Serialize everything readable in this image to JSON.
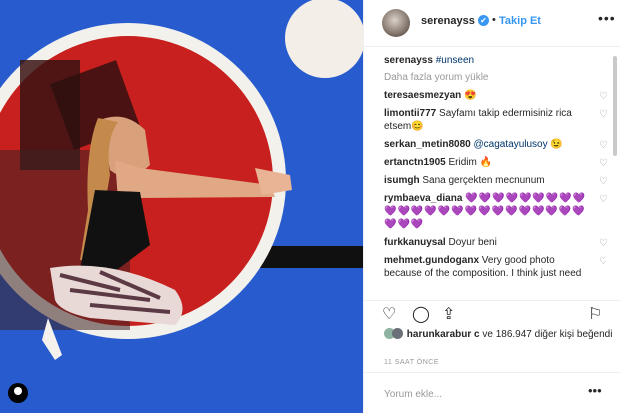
{
  "post": {
    "username": "serenayss",
    "verified": "✔",
    "dot": "•",
    "follow": "Takip Et",
    "more": "•••"
  },
  "caption": {
    "username": "serenayss",
    "hashtag": "#unseen"
  },
  "load_more": "Daha fazla yorum yükle",
  "comments": [
    {
      "user": "teresaesmezyan",
      "text": "😍"
    },
    {
      "user": "limontii777",
      "text": "Sayfamı takip edermisiniz rica etsem😊"
    },
    {
      "user": "serkan_metin8080",
      "text": "@cagatayulusoy 😉"
    },
    {
      "user": "ertanctn1905",
      "text": "Eridim 🔥"
    },
    {
      "user": "isumgh",
      "text": "Sana gerçekten mecnunum"
    },
    {
      "user": "rymbaeva_diana",
      "text": "💜💜💜💜💜💜💜💜💜💜💜💜💜💜💜💜💜💜💜💜💜💜💜💜💜💜💜"
    },
    {
      "user": "furkkanuysal",
      "text": "Doyur beni"
    },
    {
      "user": "mehmet.gundoganx",
      "text": "Very good photo because of the composition. I think just need some lighting in this"
    }
  ],
  "likes": {
    "user": "harunkarabur c",
    "rest": "ve 186.947 diğer kişi beğendi"
  },
  "time": "11 SAAT ÖNCE",
  "add_comment": {
    "placeholder": "Yorum ekle...",
    "more": "•••"
  },
  "icons": {
    "heart": "heart-icon",
    "comment": "comment-icon",
    "share": "share-icon",
    "save": "bookmark-icon"
  },
  "colors": {
    "photo_bg": "#2f64d6",
    "accent": "#3897f0",
    "circle_red": "#c8201e"
  }
}
